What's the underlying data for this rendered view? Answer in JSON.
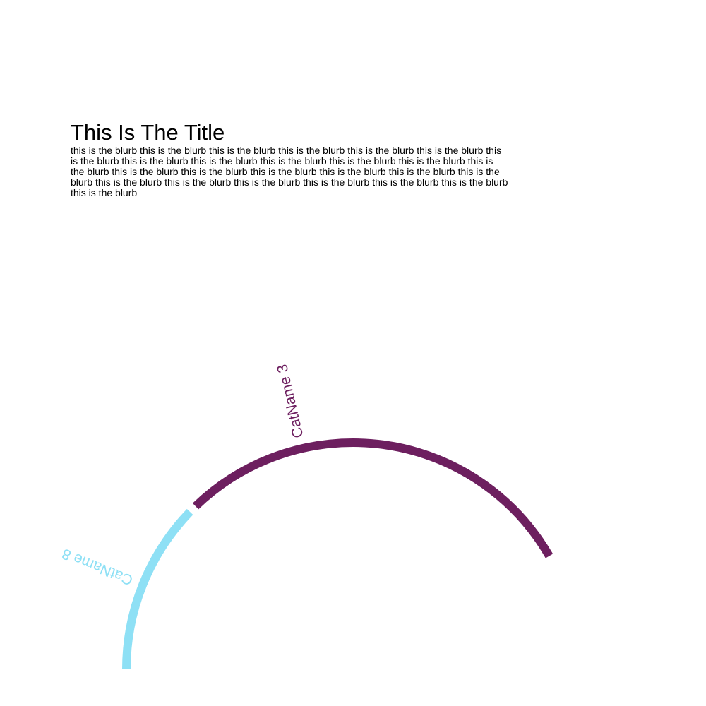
{
  "title": "This Is The Title",
  "blurb": "this is the blurb this is the blurb this is the blurb this is the blurb this is the blurb this is the blurb this is the blurb this is the blurb this is the blurb this is the blurb this is the blurb this is the blurb this is the blurb this is the blurb this is the blurb this is the blurb this is the blurb this is the blurb this is the blurb this is the blurb this is the blurb this is the blurb this is the blurb this is the blurb this is the blurb this is the blurb",
  "chart_data": {
    "type": "radial-arc",
    "title": "",
    "series": [
      {
        "label": "CatName 3",
        "color": "#6d1f5f",
        "start_angle_deg": -44,
        "end_angle_deg": 60,
        "label_angle_deg": -13
      },
      {
        "label": "CatName 8",
        "color": "#8ee0f5",
        "start_angle_deg": -90,
        "end_angle_deg": -46,
        "label_angle_deg": -68
      }
    ]
  }
}
